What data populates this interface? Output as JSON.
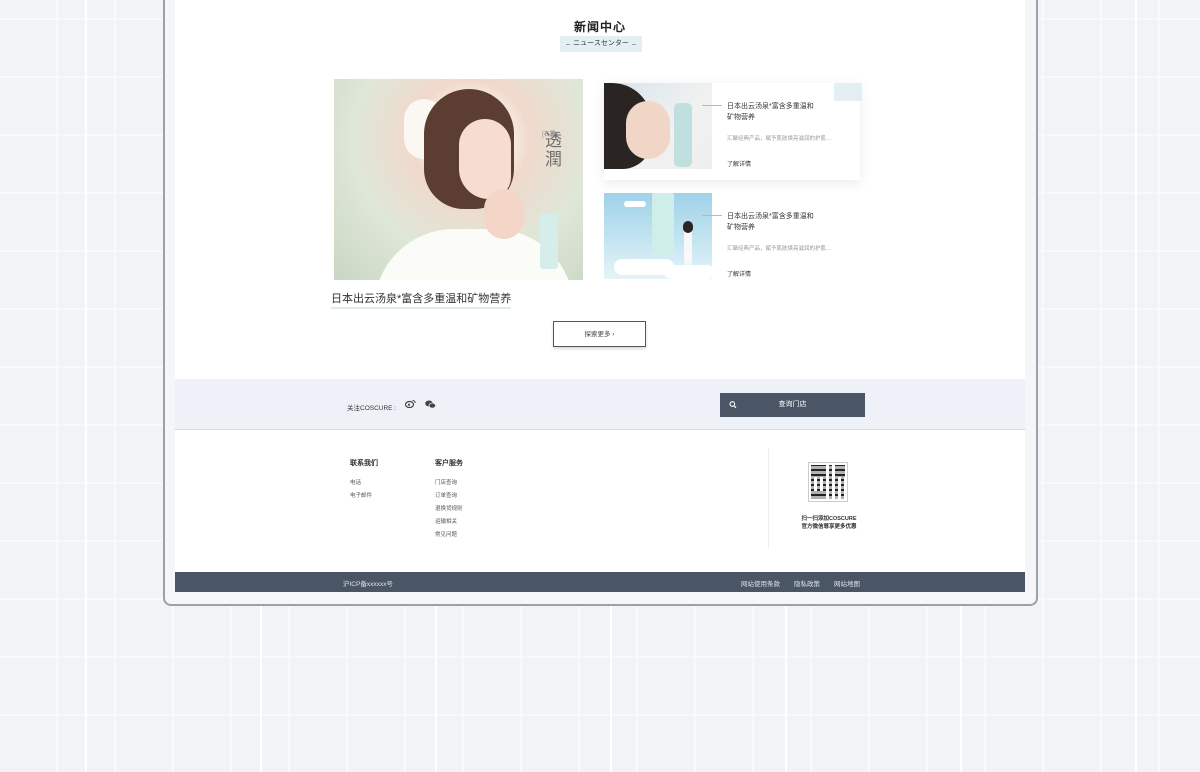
{
  "news": {
    "title": "新闻中心",
    "subtitle": "ニュースセンター",
    "feature": {
      "vertical_text": "透潤",
      "tag": "[右置]",
      "caption": "日本出云汤泉*富含多重温和矿物营养"
    },
    "cards": [
      {
        "title": "日本出云汤泉*富含多重温和矿物营养",
        "desc": "汇聚经典产品，赋予肌肤焕亮滋润的护肌…",
        "more": "了解详情"
      },
      {
        "title": "日本出云汤泉*富含多重温和矿物营养",
        "desc": "汇聚经典产品，赋予肌肤焕亮滋润的护肌…",
        "more": "了解详情"
      }
    ],
    "explore": "探索更多  ›"
  },
  "follow": {
    "label": "关注COSCURE :",
    "icons": [
      "weibo-icon",
      "wechat-icon"
    ],
    "store_button": "查询门店"
  },
  "footer": {
    "contact": {
      "heading": "联系我们",
      "items": [
        "电话",
        "电子邮件"
      ]
    },
    "service": {
      "heading": "客户服务",
      "items": [
        "门店查询",
        "订单查询",
        "退换货规则",
        "运输相关",
        "常见问题"
      ]
    },
    "qr_text_1": "扫一扫添加COSCURE",
    "qr_text_2": "官方微信尊享更多优惠",
    "icp": "沪ICP备xxxxxx号",
    "links": [
      "网站使用条款",
      "隐私政策",
      "网站地图"
    ]
  },
  "colors": {
    "accent": "#4a5566",
    "light_band": "#eef1f7",
    "pale_teal": "#e4eff4"
  }
}
